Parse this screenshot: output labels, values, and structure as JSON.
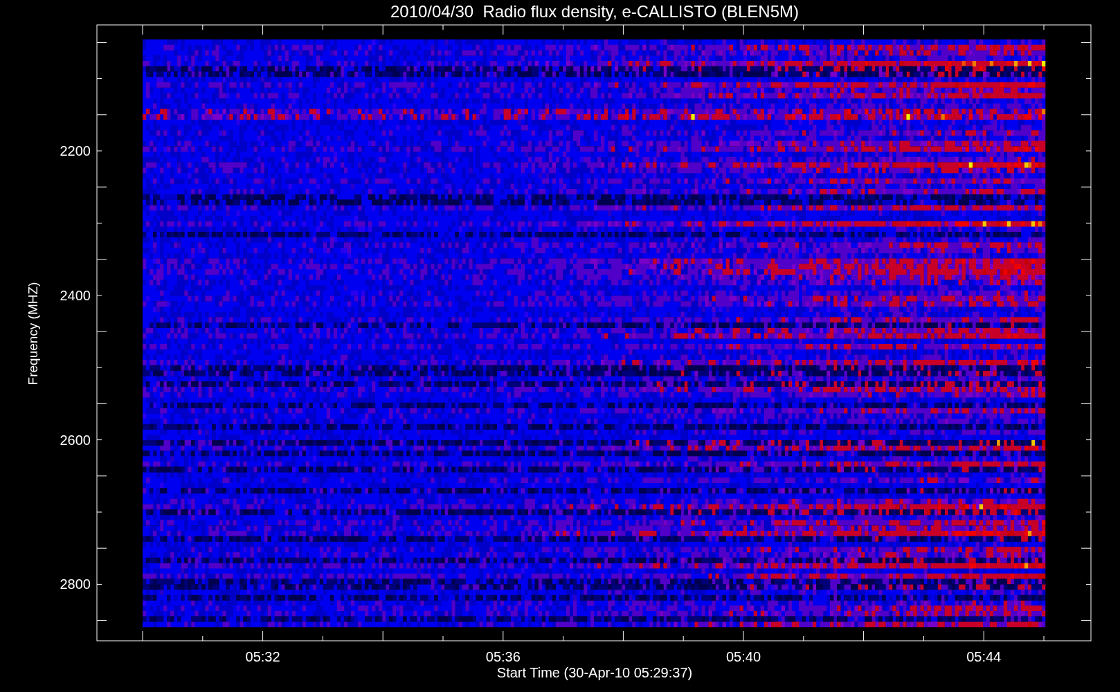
{
  "plot": {
    "title": "2010/04/30  Radio flux density, e-CALLISTO (BLEN5M)",
    "y_axis": {
      "label": "Frequency (MHZ)",
      "tick_labels": [
        "2200",
        "2400",
        "2600",
        "2800"
      ]
    },
    "x_axis": {
      "label": "Start Time (30-Apr-10 05:29:37)",
      "tick_labels": [
        "05:32",
        "05:36",
        "05:40",
        "05:44"
      ]
    }
  }
}
